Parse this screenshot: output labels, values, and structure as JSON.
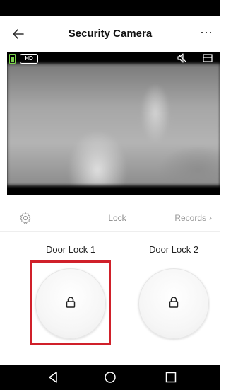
{
  "header": {
    "title": "Security Camera",
    "more_label": "⋯"
  },
  "video": {
    "quality_badge": "HD"
  },
  "controls": {
    "lock_label": "Lock",
    "records_label": "Records",
    "records_chevron": "›"
  },
  "locks": [
    {
      "name": "Door Lock 1"
    },
    {
      "name": "Door Lock 2"
    }
  ],
  "colors": {
    "accent_highlight": "#d0202a",
    "battery": "#7bd24b"
  },
  "icons": {
    "back": "back-arrow-icon",
    "more": "more-icon",
    "battery": "battery-icon",
    "mute": "speaker-mute-icon",
    "record": "record-icon",
    "settings": "gear-icon",
    "lock": "lock-icon",
    "nav_back": "nav-back-icon",
    "nav_home": "nav-home-icon",
    "nav_recents": "nav-recents-icon"
  }
}
